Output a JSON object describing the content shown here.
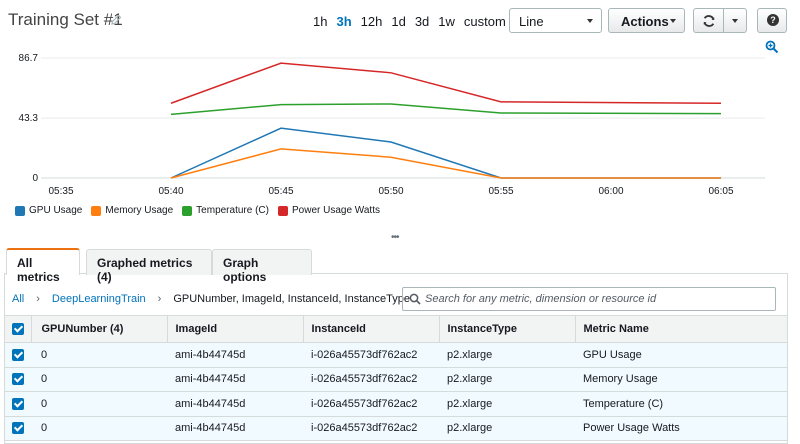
{
  "header": {
    "title": "Training Set #1",
    "time_ranges": [
      "1h",
      "3h",
      "12h",
      "1d",
      "3d",
      "1w"
    ],
    "active_range": "3h",
    "custom_label": "custom",
    "chart_type_selected": "Line",
    "actions_label": "Actions",
    "help_label": "?"
  },
  "chart_data": {
    "type": "line",
    "x": [
      "05:35",
      "05:40",
      "05:45",
      "05:50",
      "05:55",
      "06:00",
      "06:05"
    ],
    "y_ticks": [
      "0",
      "43.3",
      "86.7"
    ],
    "ylim": [
      0,
      86.7
    ],
    "grid": true,
    "legend_position": "bottom-left",
    "series": [
      {
        "name": "GPU Usage",
        "color": "#1f77b4",
        "points": [
          [
            "05:40",
            0
          ],
          [
            "05:45",
            36
          ],
          [
            "05:50",
            26
          ],
          [
            "05:55",
            0
          ],
          [
            "06:05",
            0
          ]
        ]
      },
      {
        "name": "Memory Usage",
        "color": "#ff7f0e",
        "points": [
          [
            "05:40",
            0
          ],
          [
            "05:45",
            21
          ],
          [
            "05:50",
            15
          ],
          [
            "05:55",
            0
          ],
          [
            "06:05",
            0
          ]
        ]
      },
      {
        "name": "Temperature (C)",
        "color": "#2ca02c",
        "points": [
          [
            "05:40",
            46
          ],
          [
            "05:45",
            53
          ],
          [
            "05:50",
            53.5
          ],
          [
            "05:55",
            47
          ],
          [
            "06:05",
            46.5
          ]
        ]
      },
      {
        "name": "Power Usage Watts",
        "color": "#d62728",
        "points": [
          [
            "05:40",
            54
          ],
          [
            "05:45",
            83
          ],
          [
            "05:50",
            76
          ],
          [
            "05:55",
            55
          ],
          [
            "06:05",
            54
          ]
        ]
      }
    ]
  },
  "tabs": [
    {
      "label": "All metrics",
      "active": true
    },
    {
      "label": "Graphed metrics (4)",
      "active": false
    },
    {
      "label": "Graph options",
      "active": false
    }
  ],
  "breadcrumb": {
    "root": "All",
    "namespace": "DeepLearningTrain",
    "dimensions": "GPUNumber, ImageId, InstanceId, InstanceType"
  },
  "search": {
    "placeholder": "Search for any metric, dimension or resource id"
  },
  "table": {
    "columns": [
      "GPUNumber  (4)",
      "ImageId",
      "InstanceId",
      "InstanceType",
      "Metric Name"
    ],
    "rows": [
      [
        "0",
        "ami-4b44745d",
        "i-026a45573df762ac2",
        "p2.xlarge",
        "GPU Usage"
      ],
      [
        "0",
        "ami-4b44745d",
        "i-026a45573df762ac2",
        "p2.xlarge",
        "Memory Usage"
      ],
      [
        "0",
        "ami-4b44745d",
        "i-026a45573df762ac2",
        "p2.xlarge",
        "Temperature (C)"
      ],
      [
        "0",
        "ami-4b44745d",
        "i-026a45573df762ac2",
        "p2.xlarge",
        "Power Usage Watts"
      ]
    ]
  }
}
